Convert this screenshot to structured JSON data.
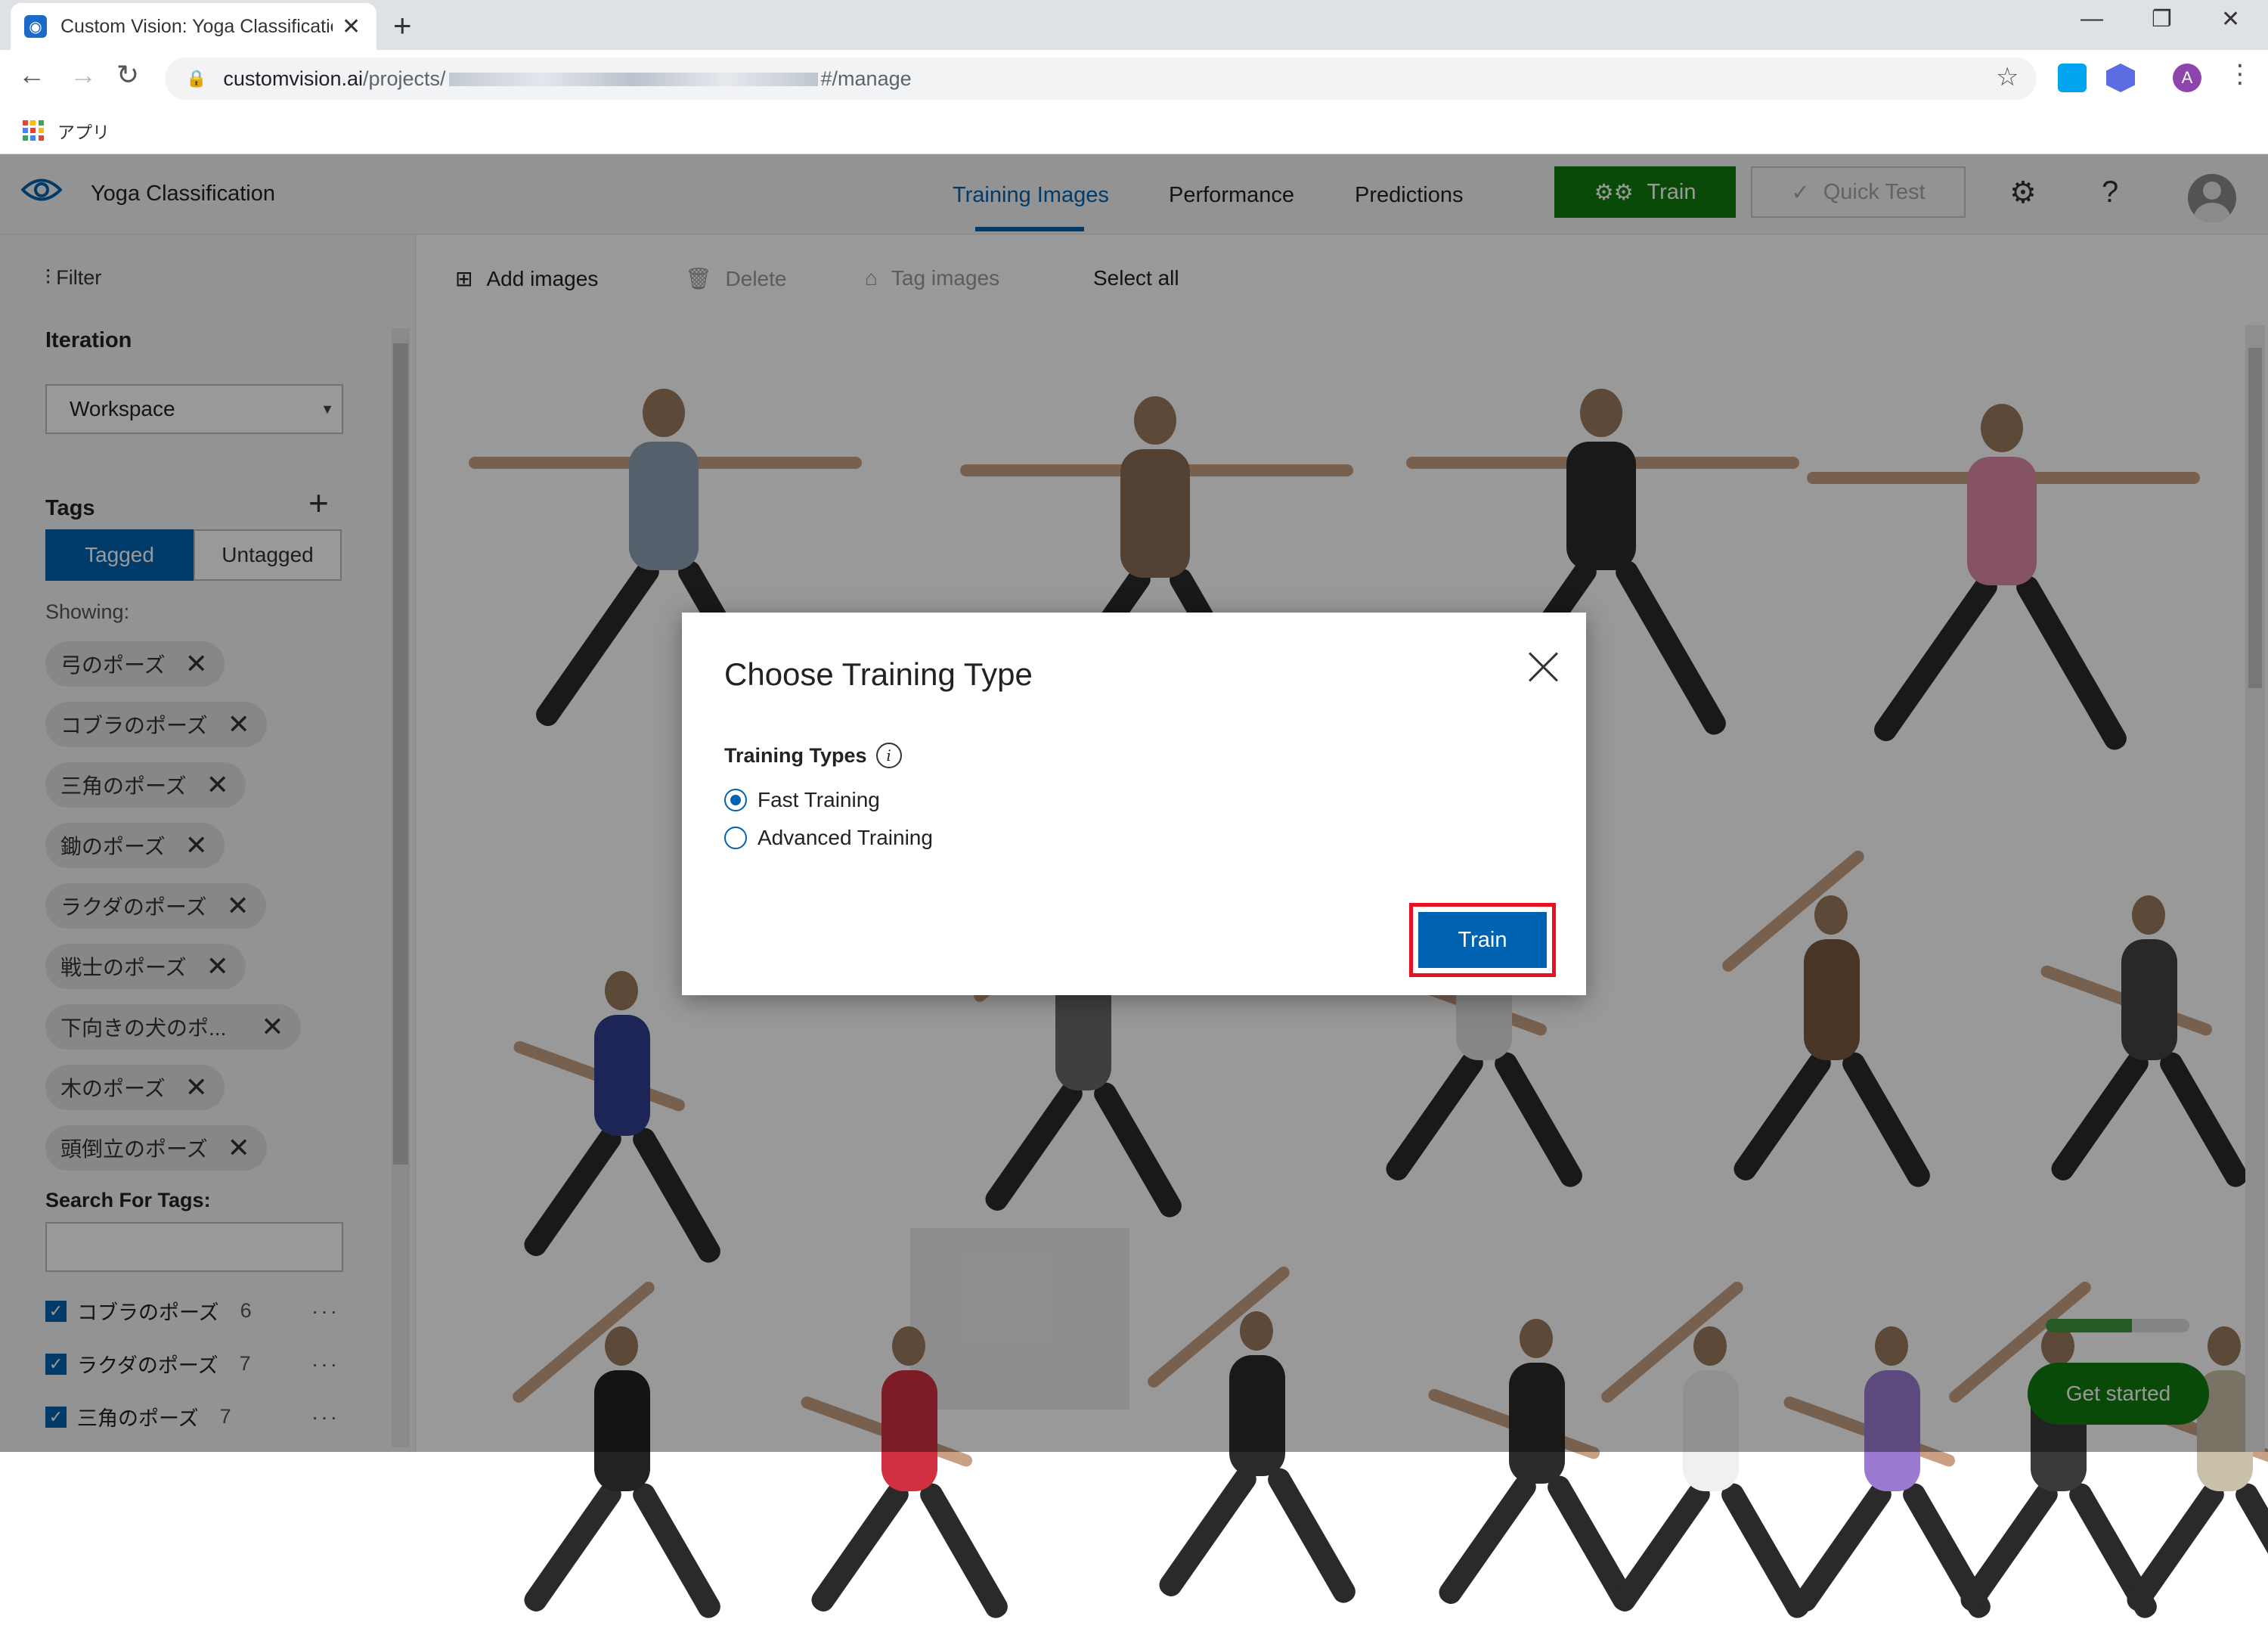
{
  "browser": {
    "tab_title": "Custom Vision: Yoga Classificatio",
    "tab_favicon": "custom-vision-favicon",
    "url_host": "customvision.ai",
    "url_path_prefix": "/projects/",
    "url_path_suffix": "#/manage",
    "bookmarks": [
      {
        "label": "アプリ",
        "icon": "apps-grid-icon"
      }
    ],
    "avatar_letter": "A"
  },
  "app": {
    "project_name": "Yoga Classification",
    "nav_tabs": [
      "Training Images",
      "Performance",
      "Predictions"
    ],
    "active_tab": "Training Images",
    "train_label": "Train",
    "quick_test_label": "Quick Test",
    "brand_colors": {
      "primary": "#0063b1",
      "train_green": "#107c10",
      "highlight_red": "#e81123"
    }
  },
  "sidebar": {
    "filter_label": "Filter",
    "iteration_heading": "Iteration",
    "iteration_value": "Workspace",
    "tags_heading": "Tags",
    "toggle": [
      "Tagged",
      "Untagged"
    ],
    "showing_label": "Showing:",
    "chips": [
      "弓のポーズ",
      "コブラのポーズ",
      "三角のポーズ",
      "鋤のポーズ",
      "ラクダのポーズ",
      "戦士のポーズ",
      "下向きの犬のポ...",
      "木のポーズ",
      "頭倒立のポーズ"
    ],
    "search_tags_label": "Search For Tags:",
    "tag_list": [
      {
        "name": "コブラのポーズ",
        "count": "6"
      },
      {
        "name": "ラクダのポーズ",
        "count": "7"
      },
      {
        "name": "三角のポーズ",
        "count": "7"
      }
    ]
  },
  "toolbar": {
    "add_images": "Add images",
    "delete": "Delete",
    "tag_images": "Tag images",
    "select_all": "Select all"
  },
  "progress": {
    "fraction": 0.6
  },
  "get_started": "Get started",
  "modal": {
    "title": "Choose Training Type",
    "section_label": "Training Types",
    "options": [
      "Fast Training",
      "Advanced Training"
    ],
    "selected_option": "Fast Training",
    "train_button": "Train"
  }
}
